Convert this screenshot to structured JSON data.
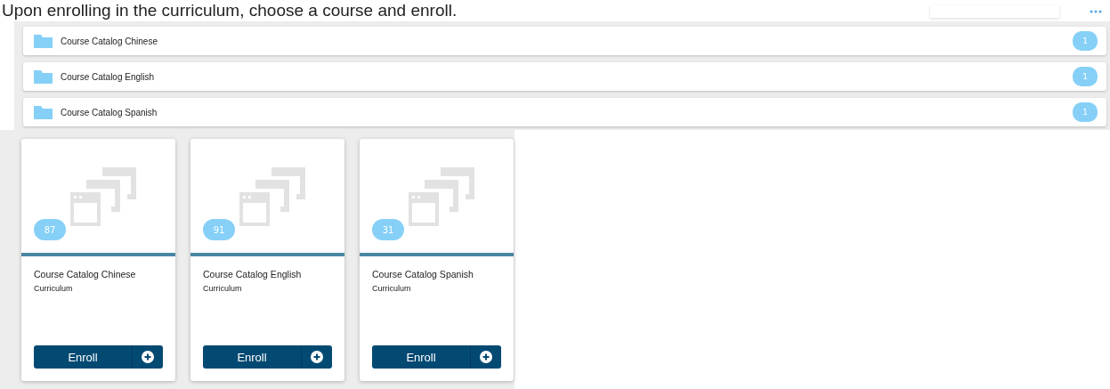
{
  "instruction": "Upon enrolling in the curriculum, choose a course and enroll.",
  "catalogs": [
    {
      "name": "Course Catalog Chinese",
      "count": "1"
    },
    {
      "name": "Course Catalog English",
      "count": "1"
    },
    {
      "name": "Course Catalog Spanish",
      "count": "1"
    }
  ],
  "cards": [
    {
      "count": "87",
      "title": "Course Catalog Chinese",
      "type": "Curriculum",
      "button": "Enroll"
    },
    {
      "count": "91",
      "title": "Course Catalog English",
      "type": "Curriculum",
      "button": "Enroll"
    },
    {
      "count": "31",
      "title": "Course Catalog Spanish",
      "type": "Curriculum",
      "button": "Enroll"
    }
  ]
}
